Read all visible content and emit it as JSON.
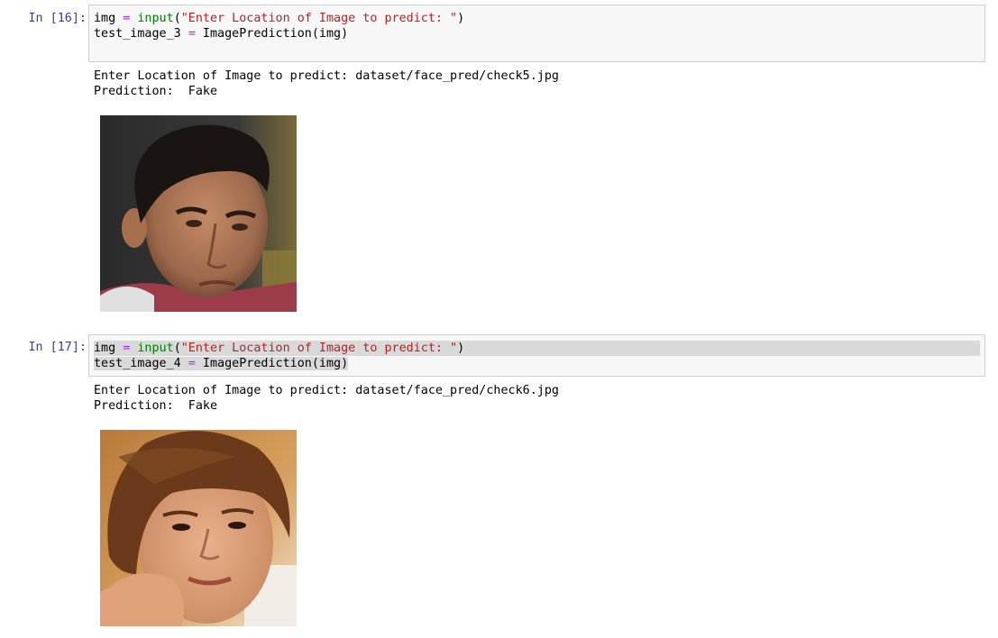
{
  "cells": [
    {
      "prompt": "In [16]:",
      "code": {
        "line1": {
          "var": "img ",
          "op": "=",
          "sp": " ",
          "fn": "input",
          "open": "(",
          "str": "\"Enter Location of Image to predict: \"",
          "close": ")"
        },
        "line2": {
          "var": "test_image_3 ",
          "op": "=",
          "rest": " ImagePrediction(img)"
        }
      },
      "output": {
        "line1": "Enter Location of Image to predict: dataset/face_pred/check5.jpg",
        "line2": "Prediction:  Fake"
      },
      "image": "face-photo-man"
    },
    {
      "prompt": "In [17]:",
      "code": {
        "line1": {
          "var": "img ",
          "op": "=",
          "sp": " ",
          "fn": "input",
          "open": "(",
          "str": "\"Enter Location of Image to predict: \"",
          "close": ")"
        },
        "line2": {
          "var": "test_image_4 ",
          "op": "=",
          "rest": " ImagePrediction(img)"
        }
      },
      "output": {
        "line1": "Enter Location of Image to predict: dataset/face_pred/check6.jpg",
        "line2": "Prediction:  Fake"
      },
      "image": "face-photo-woman"
    }
  ],
  "colors": {
    "prompt": "#303f9f",
    "string": "#ba2121",
    "builtin": "#008000",
    "operator": "#aa22ff",
    "input_bg": "#f7f7f7",
    "input_border": "#cfcfcf",
    "selection": "#d9d9d9"
  }
}
